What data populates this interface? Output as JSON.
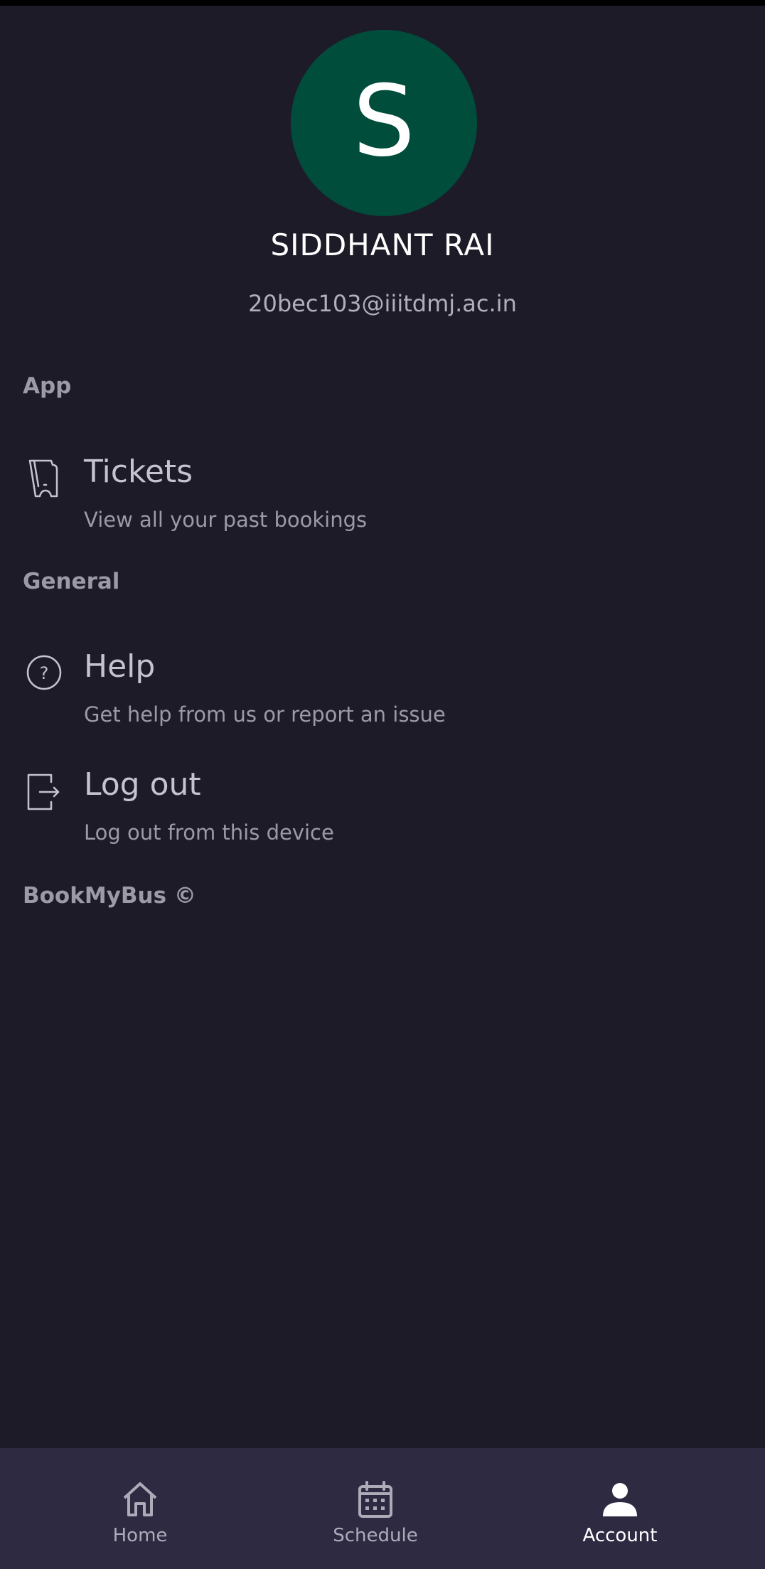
{
  "profile": {
    "avatar_letter": "S",
    "name": "SIDDHANT RAI",
    "email": "20bec103@iiitdmj.ac.in"
  },
  "sections": {
    "app": "App",
    "general": "General"
  },
  "menu": {
    "tickets": {
      "title": "Tickets",
      "subtitle": "View all your past bookings",
      "icon": "ticket-icon"
    },
    "help": {
      "title": "Help",
      "subtitle": "Get help from us or report an issue",
      "icon": "help-circle-icon"
    },
    "logout": {
      "title": "Log out",
      "subtitle": "Log out from this device",
      "icon": "logout-icon"
    }
  },
  "footer": {
    "brand": "BookMyBus ©"
  },
  "bottom_nav": {
    "items": [
      {
        "label": "Home",
        "icon": "home-icon",
        "active": false
      },
      {
        "label": "Schedule",
        "icon": "calendar-icon",
        "active": false
      },
      {
        "label": "Account",
        "icon": "person-icon",
        "active": true
      }
    ]
  },
  "colors": {
    "background": "#1e1b29",
    "avatar": "#004d3c",
    "nav_background": "#2e2a42"
  }
}
